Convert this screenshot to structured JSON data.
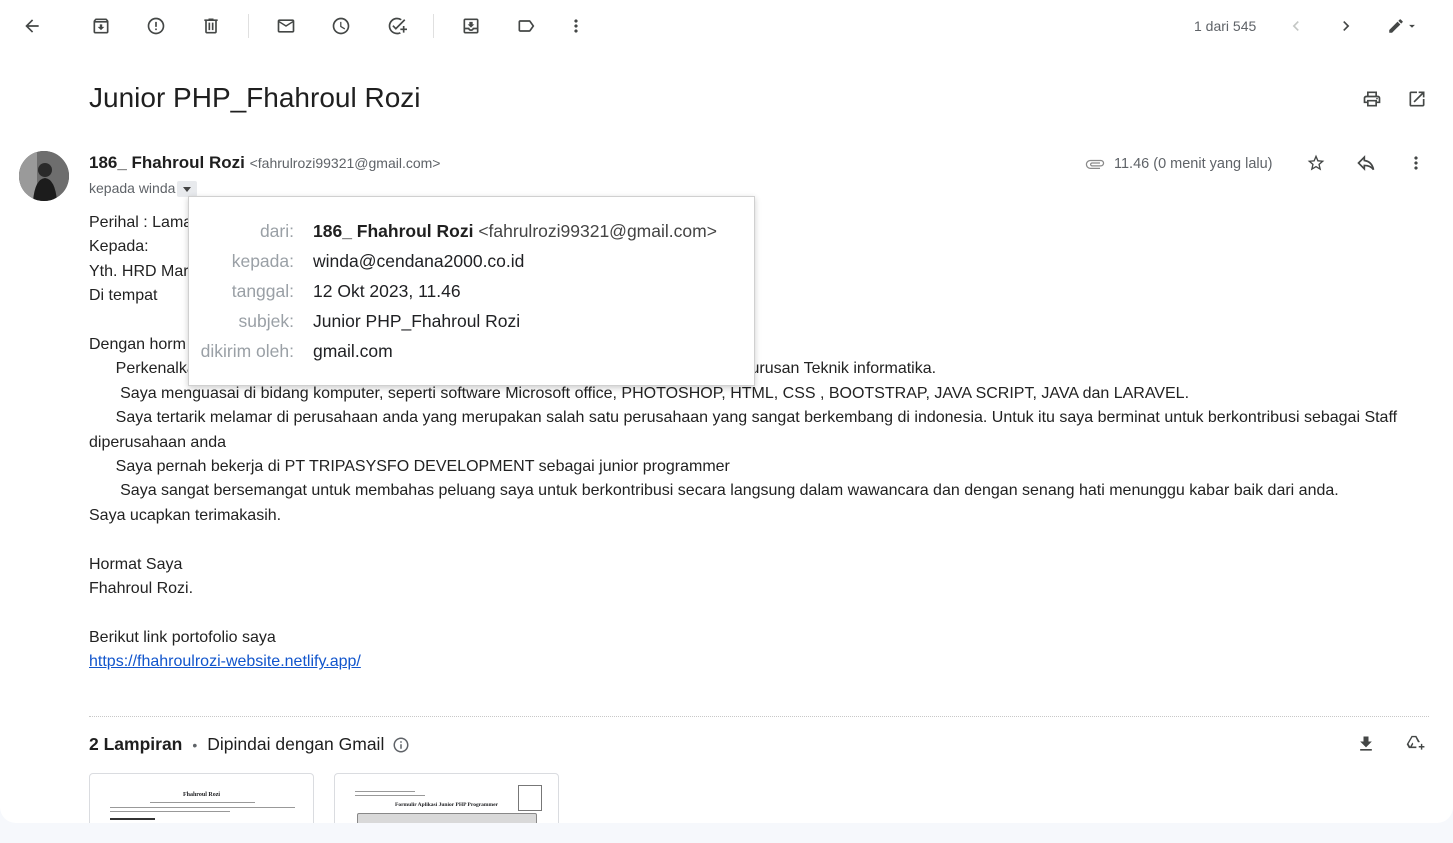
{
  "toolbar": {
    "counter": "1 dari 545"
  },
  "email": {
    "subject": "Junior PHP_Fhahroul Rozi",
    "sender_name": "186_ Fhahroul Rozi",
    "sender_email": "<fahrulrozi99321@gmail.com>",
    "recipient_line": "kepada winda",
    "time": "11.46 (0 menit yang lalu)"
  },
  "popup": {
    "rows": [
      {
        "label": "dari:",
        "name": "186_ Fhahroul Rozi",
        "value": "<fahrulrozi99321@gmail.com>"
      },
      {
        "label": "kepada:",
        "value": "winda@cendana2000.co.id"
      },
      {
        "label": "tanggal:",
        "value": "12 Okt 2023, 11.46"
      },
      {
        "label": "subjek:",
        "value": "Junior PHP_Fhahroul Rozi"
      },
      {
        "label": "dikirim oleh:",
        "value": "gmail.com"
      }
    ]
  },
  "body": {
    "lines": [
      "Perihal : Lama",
      "Kepada:",
      "Yth. HRD Mar",
      "Di tempat",
      "",
      "Dengan horm",
      "      Perkenalka                                                                                                                            jurusan Teknik informatika.",
      "       Saya menguasai di bidang komputer, seperti software Microsoft office, PHOTOSHOP, HTML, CSS , BOOTSTRAP, JAVA SCRIPT, JAVA dan LARAVEL.",
      "      Saya tertarik melamar di perusahaan anda yang merupakan salah satu perusahaan yang sangat berkembang di indonesia. Untuk itu saya berminat untuk berkontribusi sebagai Staff diperusahaan anda",
      "      Saya pernah bekerja di PT TRIPASYSFO DEVELOPMENT sebagai junior programmer",
      "       Saya sangat bersemangat untuk membahas peluang saya untuk berkontribusi secara langsung dalam wawancara dan dengan senang hati menunggu kabar baik dari anda.",
      "Saya ucapkan terimakasih.",
      "",
      "Hormat Saya",
      "Fhahroul Rozi.",
      "",
      "Berikut link portofolio saya"
    ],
    "link": "https://fhahroulrozi-website.netlify.app/"
  },
  "attachments": {
    "count_label": "2 Lampiran",
    "scan_label": "Dipindai dengan Gmail",
    "items": [
      {
        "title": "Fhahroul Rozi"
      },
      {
        "title": "Formulir Aplikasi Junior PHP Programmer"
      }
    ]
  }
}
